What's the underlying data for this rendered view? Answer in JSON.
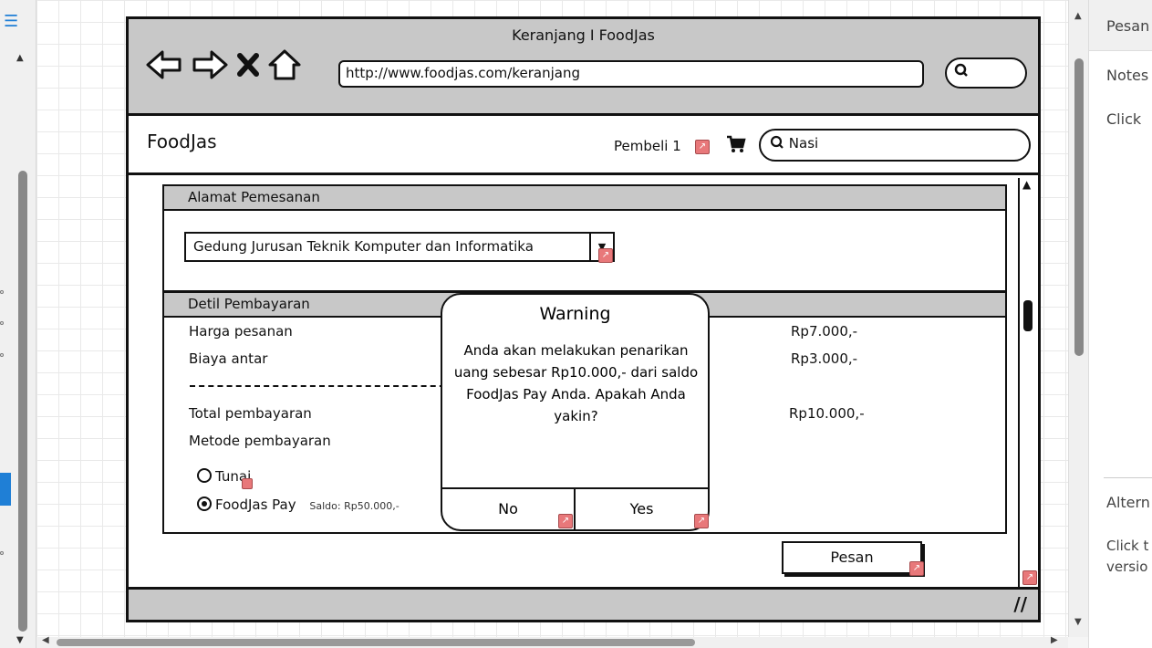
{
  "editor": {
    "right_tab": "Pesan",
    "right_notes": "Notes",
    "right_click": "Click",
    "right_alt": "Altern",
    "right_click2": "Click t",
    "right_version": "versio"
  },
  "browser": {
    "title": "Keranjang I FoodJas",
    "url": "http://www.foodjas.com/keranjang"
  },
  "app": {
    "brand": "FoodJas",
    "user": "Pembeli 1",
    "search_value": "Nasi"
  },
  "address": {
    "header": "Alamat Pemesanan",
    "value": "Gedung Jurusan Teknik Komputer dan Informatika"
  },
  "payment": {
    "header": "Detil Pembayaran",
    "order_label": "Harga pesanan",
    "order_value": "Rp7.000,-",
    "delivery_label": "Biaya antar",
    "delivery_value": "Rp3.000,-",
    "total_label": "Total pembayaran",
    "total_value": "Rp10.000,-",
    "method_label": "Metode pembayaran",
    "option_cash": "Tunai",
    "option_pay": "FoodJas Pay",
    "balance": "Saldo: Rp50.000,-",
    "selected": "FoodJas Pay"
  },
  "actions": {
    "order_button": "Pesan"
  },
  "dialog": {
    "title": "Warning",
    "message": "Anda akan melakukan penarikan uang sebesar Rp10.000,- dari saldo FoodJas Pay Anda. Apakah Anda yakin?",
    "no": "No",
    "yes": "Yes"
  }
}
